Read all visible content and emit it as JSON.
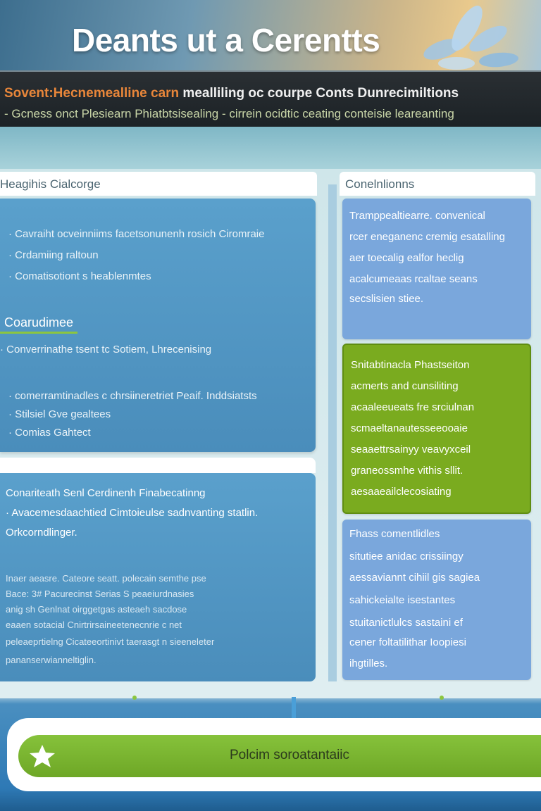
{
  "header": {
    "title": "Deants ut a Cerentts"
  },
  "subbar": {
    "line1_accent": "Sovent:Hecnemealline carn",
    "line1_rest": " mealliling oc courpe Conts Dunrecimiltions",
    "line2": "- Gcness onct Plesiearn Phiatbtsisealing - cirrein ocidtic ceating conteisie leareanting"
  },
  "left": {
    "header": "Heagihis Cialcorge",
    "bullets_top": [
      "· Cavraiht ocveinniims facetsonunenh rosich Ciromraie",
      "· Crdamiing raltoun",
      "· Comatisotiont s heablenmtes"
    ],
    "subheading": "Coarudimee",
    "bullet_mid": "· Converrinathe tsent tc Sotiem, Lhrecenising",
    "bullets_bottom": [
      "· comerramtinadles c chrsiineretriet Peaif. Inddsiatsts",
      "· Stilsiel Gve gealtees",
      "· Comias Gahtect"
    ],
    "panel_b": {
      "lines": [
        "Conariteath Senl Cerdinenh Finabecatinng",
        "· Avacemesdaachtied Cimtoieulse sadnvanting statlin.",
        "Orkcorndlinger."
      ],
      "small_lines": [
        "Inaer aeasre. Cateore seatt. polecain semthe pse",
        "Bace: 3# Pacurecinst Serias S peaeiurdnasies",
        "anig sh Genlnat oirggetgas asteaeh sacdose",
        "eaaen sotacial Cnirtrirsaineetenecnrie c net",
        "peleaeprtielng Cicateeortinivt taerasgt n sieeneleter",
        "pananserwianneltiglin."
      ]
    }
  },
  "right": {
    "header": "Conelnlionns",
    "card1": [
      "Tramppealtiearre. convenical",
      "rcer eneganenc cremig esatalling",
      "aer toecalig ealfor heclig",
      "acalcumeaas rcaltae seans",
      "secslisien stiee."
    ],
    "card2": [
      "Snitabtinacla Phastseiton",
      "acmerts and cunsiliting",
      "acaaleeueats fre srciulnan",
      "scmaeltanautesseeooaie",
      "seaaettrsainyy veavyxceil",
      "graneossmhe vithis sllit.",
      "aesaaeailclecosiating"
    ],
    "card3": [
      "Fhass comentlidles",
      "situtiee anidac crissiingy",
      "aessaviannt cihiil gis sagiea",
      "sahickeialte isestantes",
      "stuitanictlulcs sastaini ef",
      "cener foltatilithar Ioopiesi",
      "ihgtilles."
    ]
  },
  "footer": {
    "label": "Polcim soroatantaiic"
  },
  "colors": {
    "panel_blue": "#5aa0cc",
    "card_blue": "#7aa7dc",
    "accent_green": "#7aab1f",
    "header_dark": "#1c2226"
  },
  "icons": [
    "leaf-decoration-icon",
    "down-arrow-icon",
    "star-leaf-icon"
  ]
}
